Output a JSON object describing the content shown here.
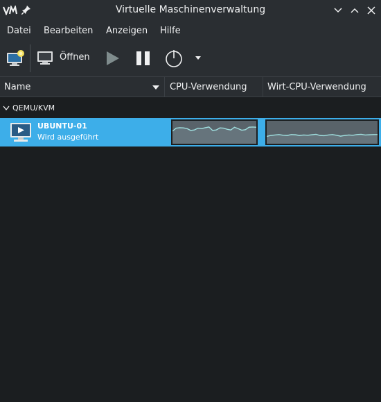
{
  "window": {
    "title": "Virtuelle Maschinenverwaltung",
    "logo_text": "VM",
    "icons": [
      "app-logo",
      "pin-icon",
      "minimize-icon",
      "maximize-icon",
      "close-icon"
    ]
  },
  "menu": {
    "datei": "Datei",
    "bearbeiten": "Bearbeiten",
    "anzeigen": "Anzeigen",
    "hilfe": "Hilfe"
  },
  "toolbar": {
    "open_label": "Öffnen",
    "icons": [
      "new-vm-icon",
      "monitor-icon",
      "play-icon",
      "pause-icon",
      "power-icon",
      "chevron-down-icon"
    ]
  },
  "columns": {
    "name": "Name",
    "cpu": "CPU-Verwendung",
    "host_cpu": "Wirt-CPU-Verwendung"
  },
  "tree": {
    "group_label": "QEMU/KVM",
    "vms": [
      {
        "name": "UBUNTU-01",
        "status": "Wird ausgeführt",
        "cpu_usage": [
          0.55,
          0.68,
          0.7,
          0.69,
          0.66,
          0.58,
          0.6,
          0.68,
          0.66,
          0.7,
          0.73,
          0.58,
          0.6,
          0.69,
          0.68,
          0.63,
          0.6,
          0.72,
          0.66,
          0.59,
          0.61,
          0.72,
          0.73,
          0.72
        ],
        "host_cpu_usage": [
          0.32,
          0.36,
          0.38,
          0.4,
          0.37,
          0.36,
          0.4,
          0.39,
          0.36,
          0.38,
          0.37,
          0.39,
          0.41,
          0.36,
          0.35,
          0.38,
          0.4,
          0.37,
          0.33,
          0.36,
          0.38,
          0.37,
          0.4,
          0.41,
          0.38,
          0.39,
          0.4,
          0.4
        ]
      }
    ]
  },
  "colors": {
    "selection": "#3daee9",
    "graph_fill": "#59636a",
    "graph_line": "#9fdfdf",
    "background": "#1b1e20",
    "chrome": "#2a2e32"
  }
}
